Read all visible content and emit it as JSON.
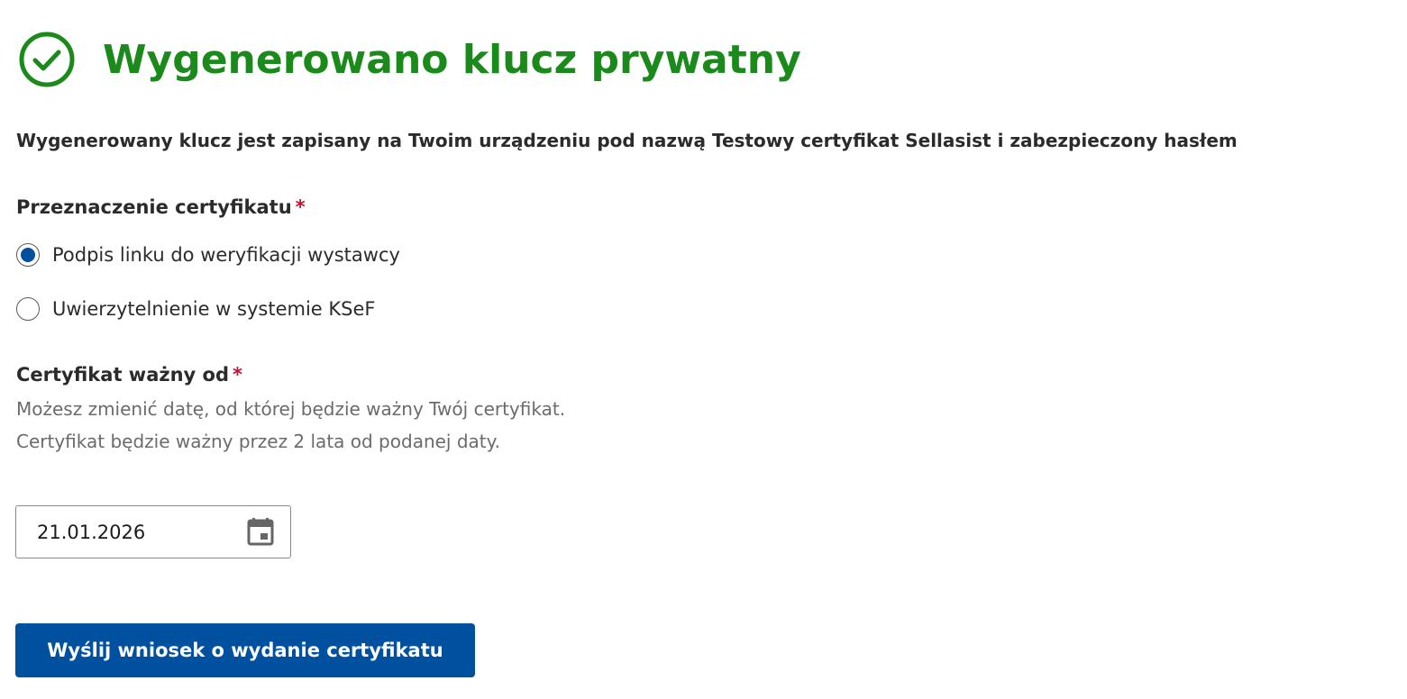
{
  "header": {
    "icon": "check-circle-icon",
    "title": "Wygenerowano klucz prywatny",
    "color": "#1a8a1a"
  },
  "info": {
    "text": "Wygenerowany klucz jest zapisany na Twoim urządzeniu pod nazwą Testowy certyfikat Sellasist i zabezpieczony hasłem"
  },
  "purpose": {
    "label": "Przeznaczenie certyfikatu",
    "required_mark": "*",
    "options": [
      {
        "label": "Podpis linku do weryfikacji wystawcy",
        "selected": true
      },
      {
        "label": "Uwierzytelnienie w systemie KSeF",
        "selected": false
      }
    ]
  },
  "validity": {
    "label": "Certyfikat ważny od",
    "required_mark": "*",
    "hint": "Możesz zmienić datę, od której będzie ważny Twój certyfikat. Certyfikat będzie ważny przez 2 lata od podanej daty.",
    "date_value": "21.01.2026",
    "icon": "calendar-icon"
  },
  "submit": {
    "label": "Wyślij wniosek o wydanie certyfikatu",
    "color": "#0050a0"
  },
  "colors": {
    "accent": "#0050a0",
    "success": "#1a8a1a",
    "required": "#c8102e"
  }
}
